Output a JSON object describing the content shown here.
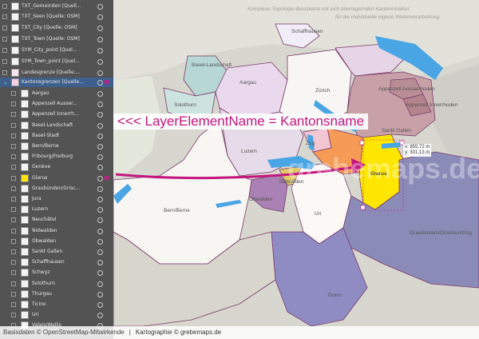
{
  "layers_panel": {
    "layers": [
      {
        "label": "TXT_Gemeinden [Quell..."
      },
      {
        "label": "TXT_Seen [Quelle: OSM]"
      },
      {
        "label": "TXT_City [Quelle: OSM]"
      },
      {
        "label": "TXT_Town [Quelle: OSM]"
      },
      {
        "label": "SYM_City_point [Quel..."
      },
      {
        "label": "SYM_Town_point [Quel..."
      },
      {
        "label": "Landesgrenze [Quelle:..."
      },
      {
        "label": "Kantonsgrenzen [Quelle..."
      }
    ],
    "sublayers": [
      "Aargau",
      "Appenzell Ausser...",
      "Appenzell Innerrh...",
      "Basel-Landschaft",
      "Basel-Stadt",
      "Bern/Berne",
      "Fribourg/Freiburg",
      "Genève",
      "Glarus",
      "Graubünden/Grisc...",
      "Jura",
      "Luzern",
      "Neuchâtel",
      "Nidwalden",
      "Obwalden",
      "Sankt Gallen",
      "Schaffhausen",
      "Schwyz",
      "Solothurn",
      "Thurgau",
      "Ticino",
      "Uri",
      "Valais/Wallis"
    ]
  },
  "map": {
    "watermark_lines": [
      "Komplexe Topologie-Basiskarte mit sich überlagernden Karteninhalten",
      "für die individuelle eigene Weiterverarbeitung."
    ],
    "annotation_text": "<<< LayerElementName = Kantonsname",
    "coordinates": {
      "x": "x: 855,72 m",
      "y": "y: 301,13 m"
    },
    "labels": [
      {
        "text": "Schaffhausen"
      },
      {
        "text": "Basel-Landschaft"
      },
      {
        "text": "Aargau"
      },
      {
        "text": "Solothurn"
      },
      {
        "text": "Zürich"
      },
      {
        "text": "Appenzell Ausserrhoden"
      },
      {
        "text": "Appenzell Innerrhoden"
      },
      {
        "text": "Sankt Gallen"
      },
      {
        "text": "Zug"
      },
      {
        "text": "Luzern"
      },
      {
        "text": "Glarus"
      },
      {
        "text": "Nidwalden"
      },
      {
        "text": "Obwalden"
      },
      {
        "text": "Bern/Berne"
      },
      {
        "text": "Uri"
      },
      {
        "text": "Graubünden/Grischun/Grig"
      },
      {
        "text": "Ticino"
      }
    ],
    "watermark_big": "grebemaps.de"
  },
  "status_bar": {
    "source": "Basisdaten © OpenStreetMap-Mitwirkende",
    "credit": "Kartographie © grebemaps.de"
  },
  "colors": {
    "selected_canton": "#ffe600",
    "accent": "#c4177e",
    "selection": "#3f5f8c"
  }
}
